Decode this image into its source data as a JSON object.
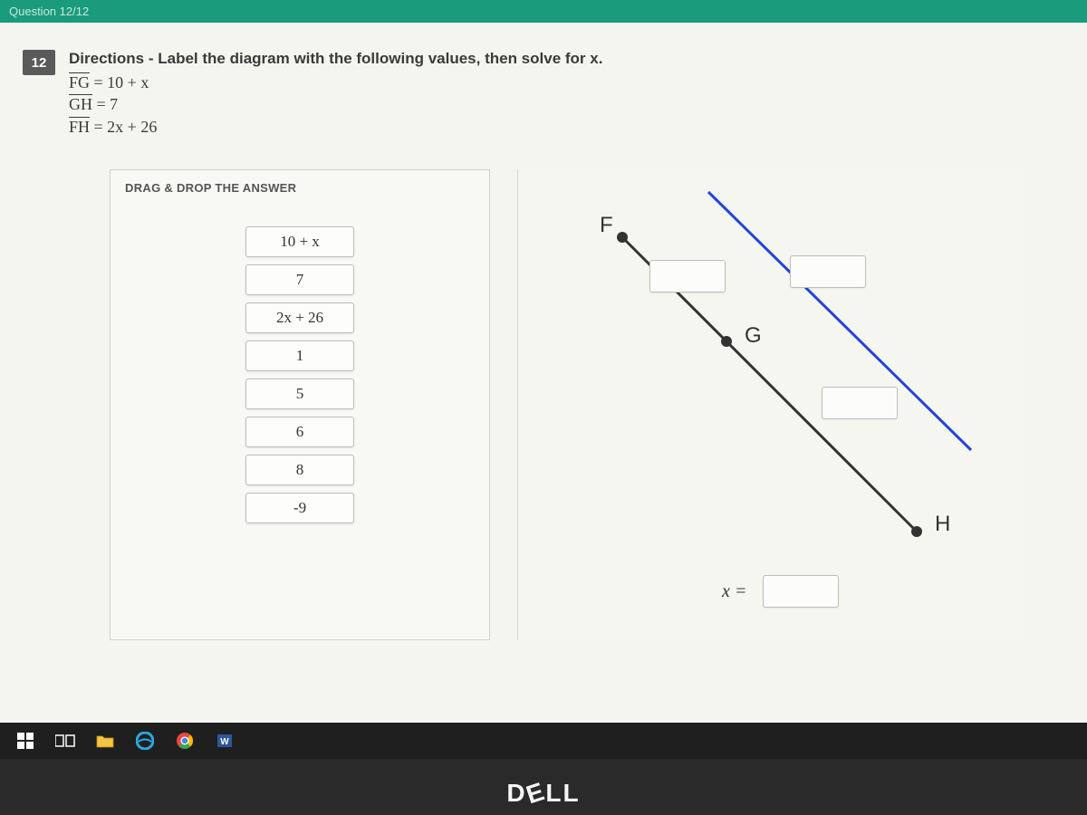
{
  "topbar": {
    "label": "Question 12/12"
  },
  "question": {
    "number": "12",
    "directions": "Directions - Label the diagram with the following values, then solve for x.",
    "given": {
      "line1_seg": "FG",
      "line1_rhs": " = 10 + x",
      "line2_seg": "GH",
      "line2_rhs": " = 7",
      "line3_seg": "FH",
      "line3_rhs": " = 2x + 26"
    }
  },
  "drag": {
    "title": "DRAG & DROP THE ANSWER",
    "chips": [
      "10 + x",
      "7",
      "2x + 26",
      "1",
      "5",
      "6",
      "8",
      "-9"
    ]
  },
  "diagram": {
    "labels": {
      "F": "F",
      "G": "G",
      "H": "H"
    },
    "xeq": "x ="
  },
  "brand": "DELL"
}
